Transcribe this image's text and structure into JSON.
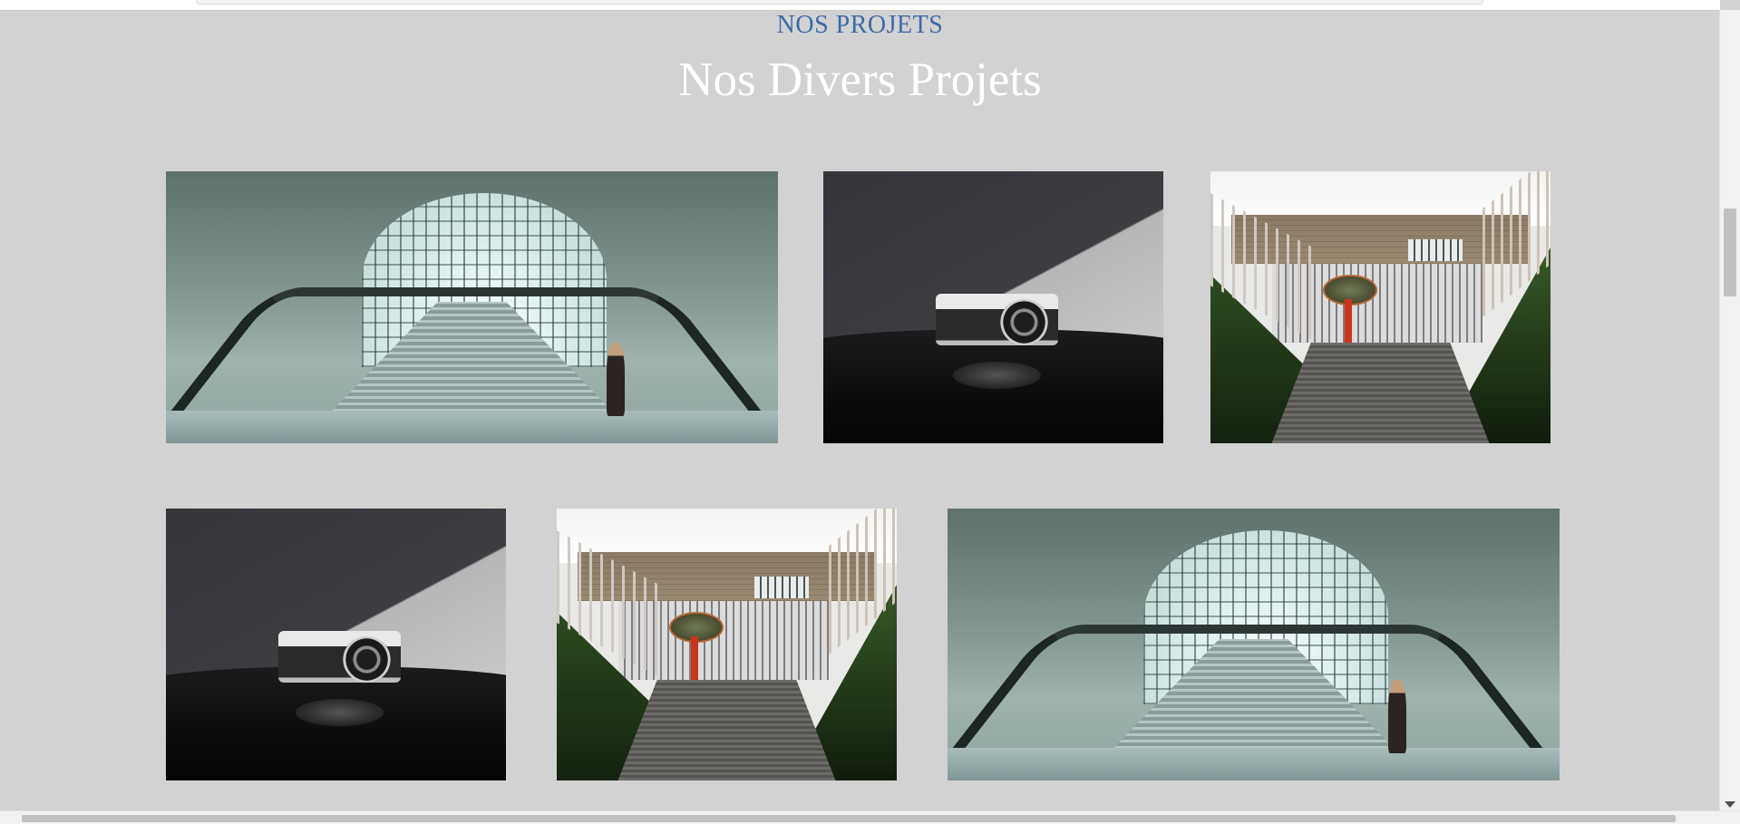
{
  "section": {
    "eyebrow": "NOS PROJETS",
    "title": "Nos Divers Projets"
  },
  "gallery": {
    "rows": [
      [
        "escalator-dome",
        "vintage-camera",
        "house-staircase"
      ],
      [
        "vintage-camera",
        "house-staircase",
        "escalator-dome"
      ]
    ]
  },
  "colors": {
    "background": "#d2d2d2",
    "eyebrow": "#3c6aa8",
    "title": "#ffffff"
  }
}
